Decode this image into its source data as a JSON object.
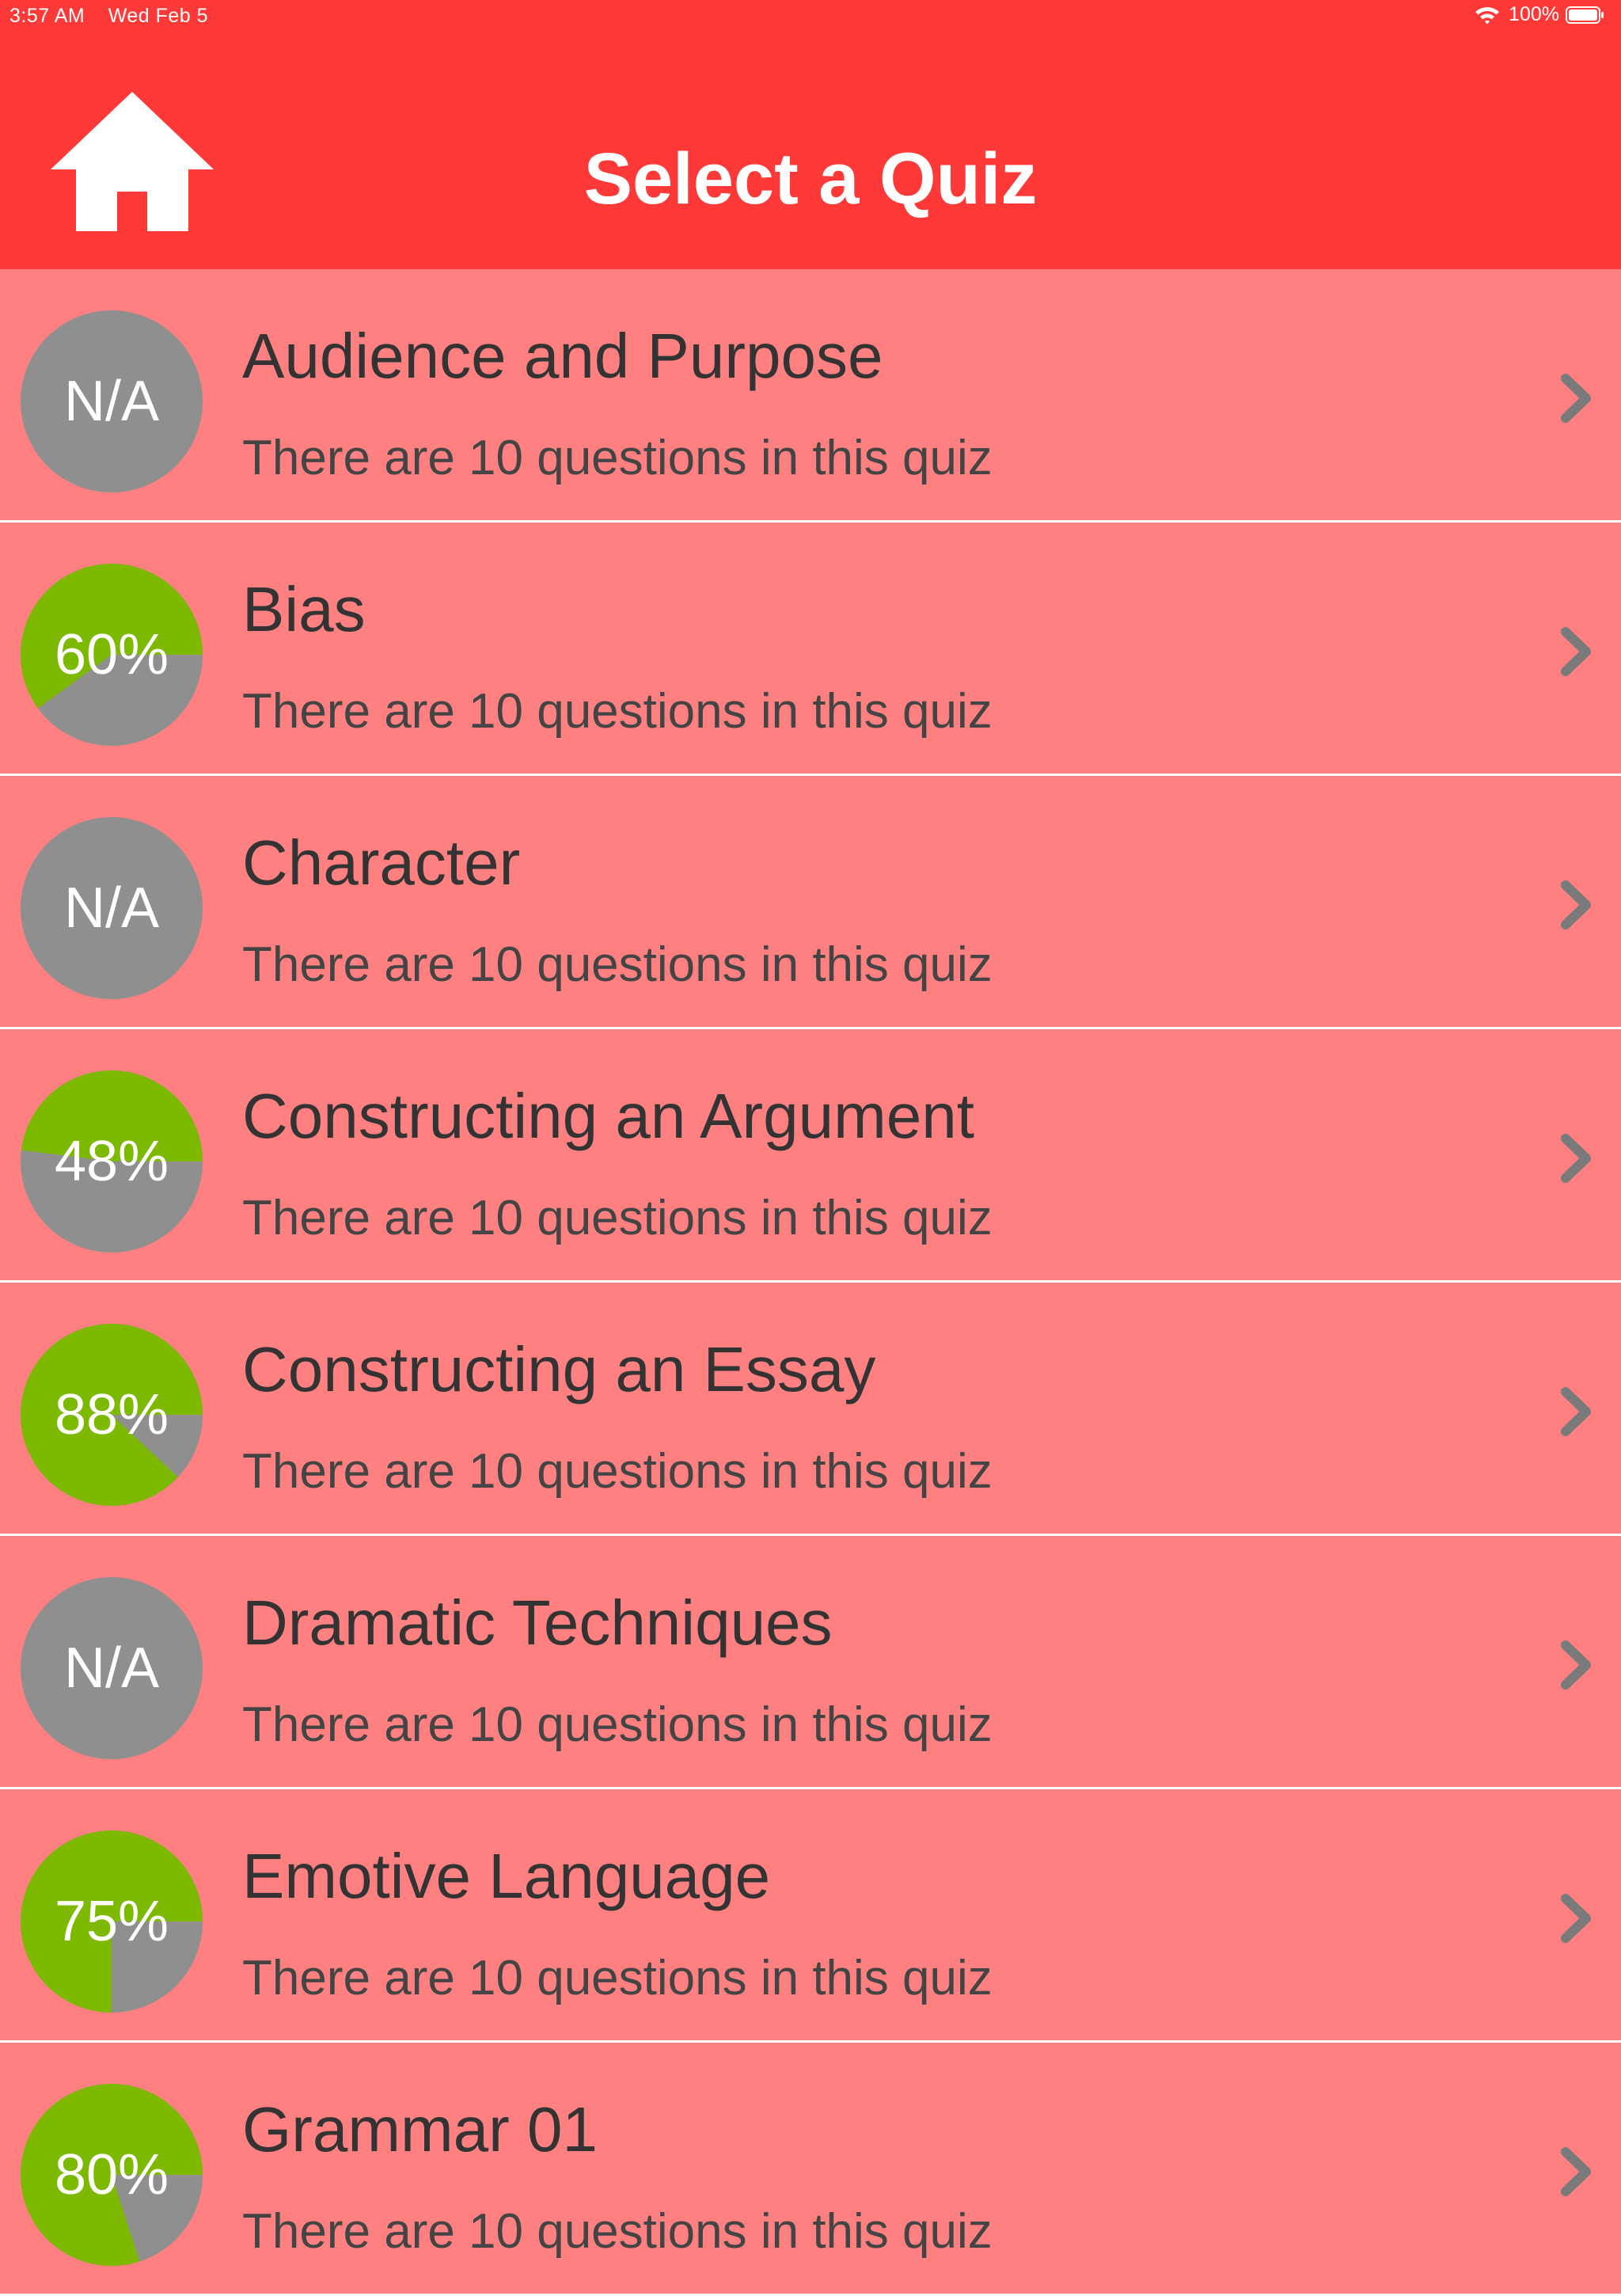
{
  "status_bar": {
    "time": "3:57 AM",
    "date": "Wed Feb 5",
    "battery": "100%"
  },
  "header": {
    "title": "Select a Quiz",
    "home_icon": "home-icon"
  },
  "colors": {
    "header_bg": "#ff3838",
    "list_bg": "#ff8080",
    "score_fill": "#7cb900",
    "score_empty": "#8f8f8f"
  },
  "quizzes": [
    {
      "title": "Audience and Purpose",
      "subtitle": "There are 10 questions in this quiz",
      "score_label": "N/A",
      "score": null
    },
    {
      "title": "Bias",
      "subtitle": "There are 10 questions in this quiz",
      "score_label": "60%",
      "score": 0.6
    },
    {
      "title": "Character",
      "subtitle": "There are 10 questions in this quiz",
      "score_label": "N/A",
      "score": null
    },
    {
      "title": "Constructing an Argument",
      "subtitle": "There are 10 questions in this quiz",
      "score_label": "48%",
      "score": 0.48
    },
    {
      "title": "Constructing an Essay",
      "subtitle": "There are 10 questions in this quiz",
      "score_label": "88%",
      "score": 0.88
    },
    {
      "title": "Dramatic Techniques",
      "subtitle": "There are 10 questions in this quiz",
      "score_label": "N/A",
      "score": null
    },
    {
      "title": "Emotive Language",
      "subtitle": "There are 10 questions in this quiz",
      "score_label": "75%",
      "score": 0.75
    },
    {
      "title": "Grammar 01",
      "subtitle": "There are 10 questions in this quiz",
      "score_label": "80%",
      "score": 0.8
    }
  ]
}
